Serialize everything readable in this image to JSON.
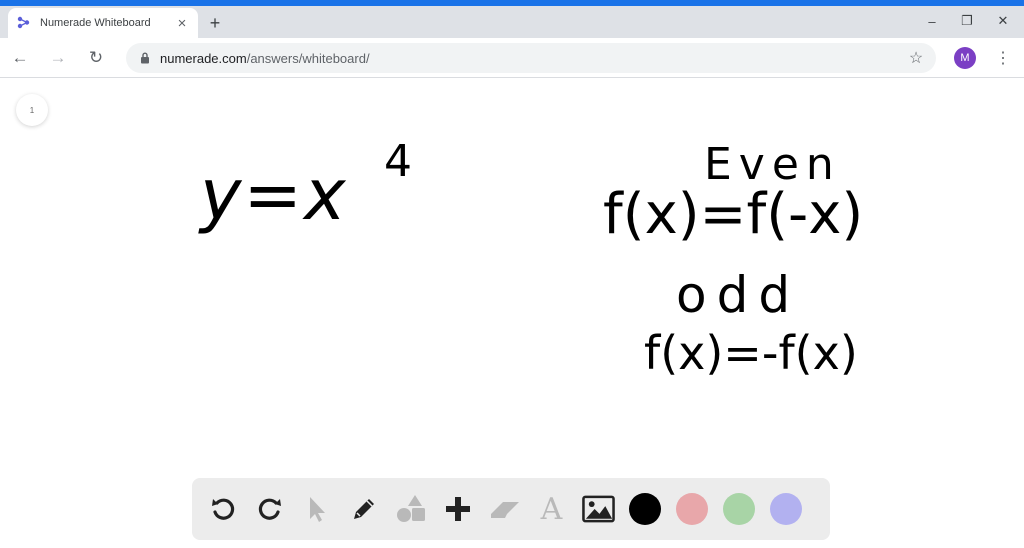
{
  "browser": {
    "tab_title": "Numerade Whiteboard",
    "tab_close": "×",
    "new_tab": "+",
    "url_host": "numerade.com",
    "url_path": "/answers/whiteboard/",
    "profile_initial": "M",
    "window_minimize": "–",
    "window_restore": "❐",
    "window_close": "✕",
    "back": "←",
    "forward": "→",
    "reload": "↻",
    "bookmark": "☆",
    "menu": "⋮"
  },
  "whiteboard": {
    "page_number": "1",
    "ink": {
      "equation_left": "y=x",
      "exponent": "4",
      "even_label": "Even",
      "even_rule": "f(x)=f(-x)",
      "odd_label": "odd",
      "odd_rule": "f(x)=-f(x)"
    }
  },
  "palette": {
    "tools": [
      "undo-icon",
      "redo-icon",
      "select-icon",
      "pen-icon",
      "shapes-icon",
      "add-icon",
      "eraser-icon",
      "text-icon",
      "image-icon"
    ],
    "text_tool_glyph": "A",
    "add_glyph": "+",
    "colors": {
      "black": "#000000",
      "red": "#e8a7aa",
      "green": "#a8d4a6",
      "blue": "#b2b1f0"
    }
  },
  "theme": {
    "accent": "#1a73e8",
    "tabbar": "#dee1e6",
    "avatar": "#7b3fc4"
  }
}
